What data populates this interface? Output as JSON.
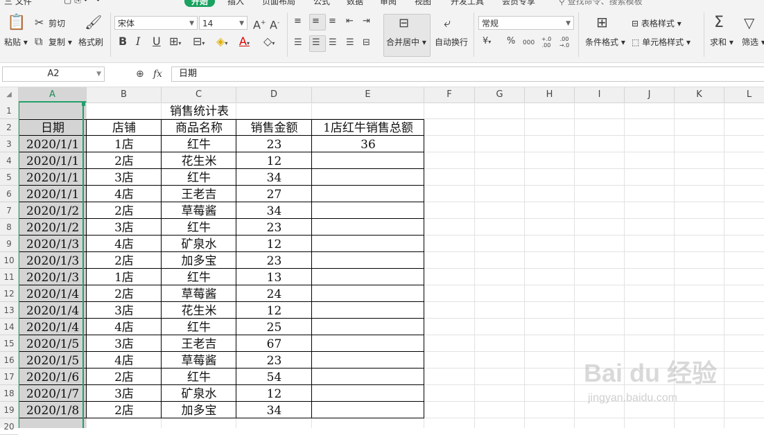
{
  "menu": {
    "items": [
      "三 文件",
      "开始",
      "插入",
      "页面布局",
      "公式",
      "数据",
      "审阅",
      "视图",
      "开发工具",
      "会员专享"
    ],
    "search_placeholder": "查找命令、搜索模板"
  },
  "ribbon": {
    "paste": "粘贴",
    "cut": "剪切",
    "copy": "复制",
    "format_painter": "格式刷",
    "font_name": "宋体",
    "font_size": "14",
    "wrap_text": "自动换行",
    "merge_center": "合并居中",
    "number_format": "常规",
    "conditional_format": "条件格式",
    "table_style": "表格样式",
    "cell_style": "单元格样式",
    "sum": "求和",
    "filter": "筛选",
    "bold": "B",
    "italic": "I",
    "underline": "U",
    "currency": "¥",
    "percent": "%",
    "thousands": "000",
    "inc_decimal": "+.0 .00",
    "dec_decimal": ".00 →.0",
    "font_color_label": "A"
  },
  "formula_bar": {
    "cell_ref": "A2",
    "fx": "fx",
    "content": "日期"
  },
  "sheet": {
    "columns": [
      "A",
      "B",
      "C",
      "D",
      "E",
      "F",
      "G",
      "H",
      "I",
      "J",
      "K",
      "L"
    ],
    "rows": [
      "1",
      "2",
      "3",
      "4",
      "5",
      "6",
      "7",
      "8",
      "9",
      "10",
      "11",
      "12",
      "13",
      "14",
      "15",
      "16",
      "17",
      "18",
      "19",
      "20"
    ],
    "title": "销售统计表",
    "headers": [
      "日期",
      "店铺",
      "商品名称",
      "销售金额",
      "1店红牛销售总额"
    ],
    "total_value": "36",
    "data": [
      [
        "2020/1/1",
        "1店",
        "红牛",
        "23"
      ],
      [
        "2020/1/1",
        "2店",
        "花生米",
        "12"
      ],
      [
        "2020/1/1",
        "3店",
        "红牛",
        "34"
      ],
      [
        "2020/1/1",
        "4店",
        "王老吉",
        "27"
      ],
      [
        "2020/1/2",
        "2店",
        "草莓酱",
        "34"
      ],
      [
        "2020/1/2",
        "3店",
        "红牛",
        "23"
      ],
      [
        "2020/1/3",
        "4店",
        "矿泉水",
        "12"
      ],
      [
        "2020/1/3",
        "2店",
        "加多宝",
        "23"
      ],
      [
        "2020/1/3",
        "1店",
        "红牛",
        "13"
      ],
      [
        "2020/1/4",
        "2店",
        "草莓酱",
        "24"
      ],
      [
        "2020/1/4",
        "3店",
        "花生米",
        "12"
      ],
      [
        "2020/1/4",
        "4店",
        "红牛",
        "25"
      ],
      [
        "2020/1/5",
        "3店",
        "王老吉",
        "67"
      ],
      [
        "2020/1/5",
        "4店",
        "草莓酱",
        "23"
      ],
      [
        "2020/1/6",
        "2店",
        "红牛",
        "54"
      ],
      [
        "2020/1/7",
        "3店",
        "矿泉水",
        "12"
      ],
      [
        "2020/1/8",
        "2店",
        "加多宝",
        "34"
      ]
    ]
  },
  "watermark": {
    "brand": "Bai du 经验",
    "url": "jingyan.baidu.com"
  },
  "colors": {
    "accent": "#1aa260",
    "selection": "#22a06b",
    "selected_fill": "#d4d4d4"
  }
}
